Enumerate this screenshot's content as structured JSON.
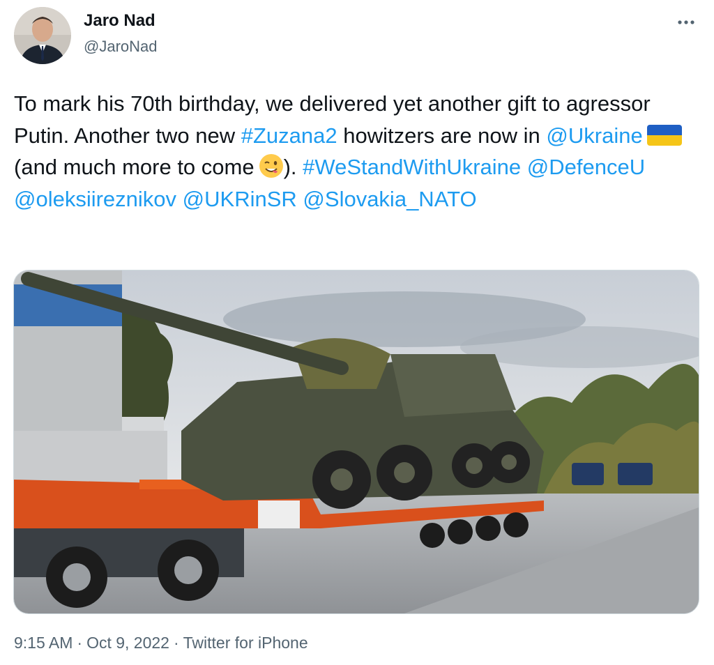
{
  "author": {
    "name": "Jaro Nad",
    "handle": "@JaroNad"
  },
  "tweet": {
    "text_line1": "To mark his 70th birthday, we delivered yet another gift to agressor Putin. Another two new ",
    "hashtag_zuzana": "#Zuzana2",
    "text_howitzers": " howitzers are now in ",
    "mention_ukraine": "@Ukraine",
    "text_paren": "(and much more to come",
    "text_close": "). ",
    "hashtag_westand": "#WeStandWithUkraine",
    "mention_defence": "@DefenceU",
    "mention_oleksii": "@oleksiireznikov",
    "mention_ukrinsr": "@UKRinSR",
    "mention_slovakia": "@Slovakia_NATO",
    "emoji": "winking-face-with-tongue-icon",
    "flag": "ukraine-flag-icon"
  },
  "meta": {
    "time": "9:15 AM",
    "date": "Oct 9, 2022",
    "source": "Twitter for iPhone"
  },
  "colors": {
    "link": "#1d9bf0",
    "text": "#0f1419",
    "secondary": "#536471",
    "truck_orange": "#e8531c",
    "vehicle_olive": "#4b5140"
  }
}
